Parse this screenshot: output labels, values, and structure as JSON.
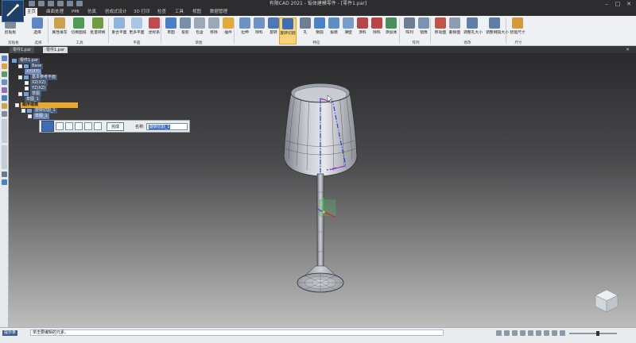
{
  "window": {
    "title": "有限CAD 2021 - 钣体建模零件 - [零件1.par]",
    "controls": [
      "–",
      "□",
      "✕"
    ]
  },
  "ribbon": {
    "tabs": [
      {
        "label": "主页"
      },
      {
        "label": "曲面处理"
      },
      {
        "label": "PMI"
      },
      {
        "label": "仿真"
      },
      {
        "label": "创成式设计"
      },
      {
        "label": "3D 打印"
      },
      {
        "label": "检查"
      },
      {
        "label": "工具"
      },
      {
        "label": "视图"
      },
      {
        "label": "数据管理"
      }
    ],
    "buttons": [
      {
        "label": "剪贴板",
        "color": "#7d8b9b"
      },
      {
        "label": "选择",
        "color": "#5e86c2"
      },
      {
        "label": "属性填写",
        "color": "#c9a24a"
      },
      {
        "label": "切换图纸",
        "color": "#4f9a57"
      },
      {
        "label": "批量转换",
        "color": "#6f9c3f"
      },
      {
        "label": "重合平面",
        "color": "#8fb4de"
      },
      {
        "label": "更多平面",
        "color": "#a9c6e8"
      },
      {
        "label": "坐标系",
        "color": "#c04b4b"
      },
      {
        "label": "草图",
        "color": "#4c7fc4"
      },
      {
        "label": "投影",
        "color": "#7a8ea8"
      },
      {
        "label": "包含",
        "color": "#9aa8b8"
      },
      {
        "label": "移除",
        "color": "#9aa8b8"
      },
      {
        "label": "插件",
        "color": "#e0a93a"
      },
      {
        "label": "拉伸",
        "color": "#6e92c4"
      },
      {
        "label": "除料",
        "color": "#6e92c4"
      },
      {
        "label": "旋转",
        "color": "#4d78b8"
      },
      {
        "label": "旋转切割",
        "color": "#3e6db5"
      },
      {
        "label": "孔",
        "color": "#6e7e92"
      },
      {
        "label": "倒圆",
        "color": "#4a82c8"
      },
      {
        "label": "拔模",
        "color": "#5f8dc6"
      },
      {
        "label": "薄壁",
        "color": "#7a9ccc"
      },
      {
        "label": "添料",
        "color": "#b84646"
      },
      {
        "label": "除料",
        "color": "#b84646"
      },
      {
        "label": "添加体",
        "color": "#4b8e5a"
      },
      {
        "label": "阵列",
        "color": "#6d7e94"
      },
      {
        "label": "镜像",
        "color": "#7b93b3"
      },
      {
        "label": "移动面",
        "color": "#c0534b"
      },
      {
        "label": "删除面",
        "color": "#8e9caf"
      },
      {
        "label": "调整孔大小",
        "color": "#5e7ea6"
      },
      {
        "label": "调整倒圆大小",
        "color": "#5e7ea6"
      },
      {
        "label": "智能尺寸",
        "color": "#d29a3a"
      }
    ],
    "groups": [
      {
        "label": "剪贴板"
      },
      {
        "label": "选择"
      },
      {
        "label": "工具"
      },
      {
        "label": "平面"
      },
      {
        "label": "草图"
      },
      {
        "label": "特征"
      },
      {
        "label": "阵列"
      },
      {
        "label": "修改"
      },
      {
        "label": "尺寸"
      }
    ]
  },
  "document_tabs": [
    {
      "label": "零件1.par"
    },
    {
      "label": "零件1.par"
    }
  ],
  "path_tree": [
    {
      "label": "零件1.par",
      "level": 0,
      "state": "normal"
    },
    {
      "label": "Base",
      "level": 1,
      "state": "normal"
    },
    {
      "label": "XY(XY)",
      "level": 2,
      "state": "sel"
    },
    {
      "label": "基本参考平面",
      "level": 1,
      "state": "normal"
    },
    {
      "label": "XZ(XZ)",
      "level": 2,
      "state": "normal"
    },
    {
      "label": "YZ(XZ)",
      "level": 2,
      "state": "normal"
    },
    {
      "label": "草图",
      "level": 1,
      "state": "normal"
    },
    {
      "label": "草图_1",
      "level": 2,
      "state": "normal"
    },
    {
      "label": "顺序建模",
      "level": 0,
      "state": "highlight"
    },
    {
      "label": "旋转切割_1",
      "level": 1,
      "state": "normal"
    },
    {
      "label": "草图_1",
      "level": 2,
      "state": "sel"
    }
  ],
  "command_bar": {
    "finish_label": "完成",
    "name_label": "名称:",
    "name_value": "旋转切割_1"
  },
  "statusbar": {
    "command_label": "提示条",
    "prompt": "单击要编辑的元素。"
  },
  "colors": {
    "accent": "#e8a92e",
    "ribbon_bg": "#eef0f3",
    "titlebar_bg": "#2d2d30"
  }
}
